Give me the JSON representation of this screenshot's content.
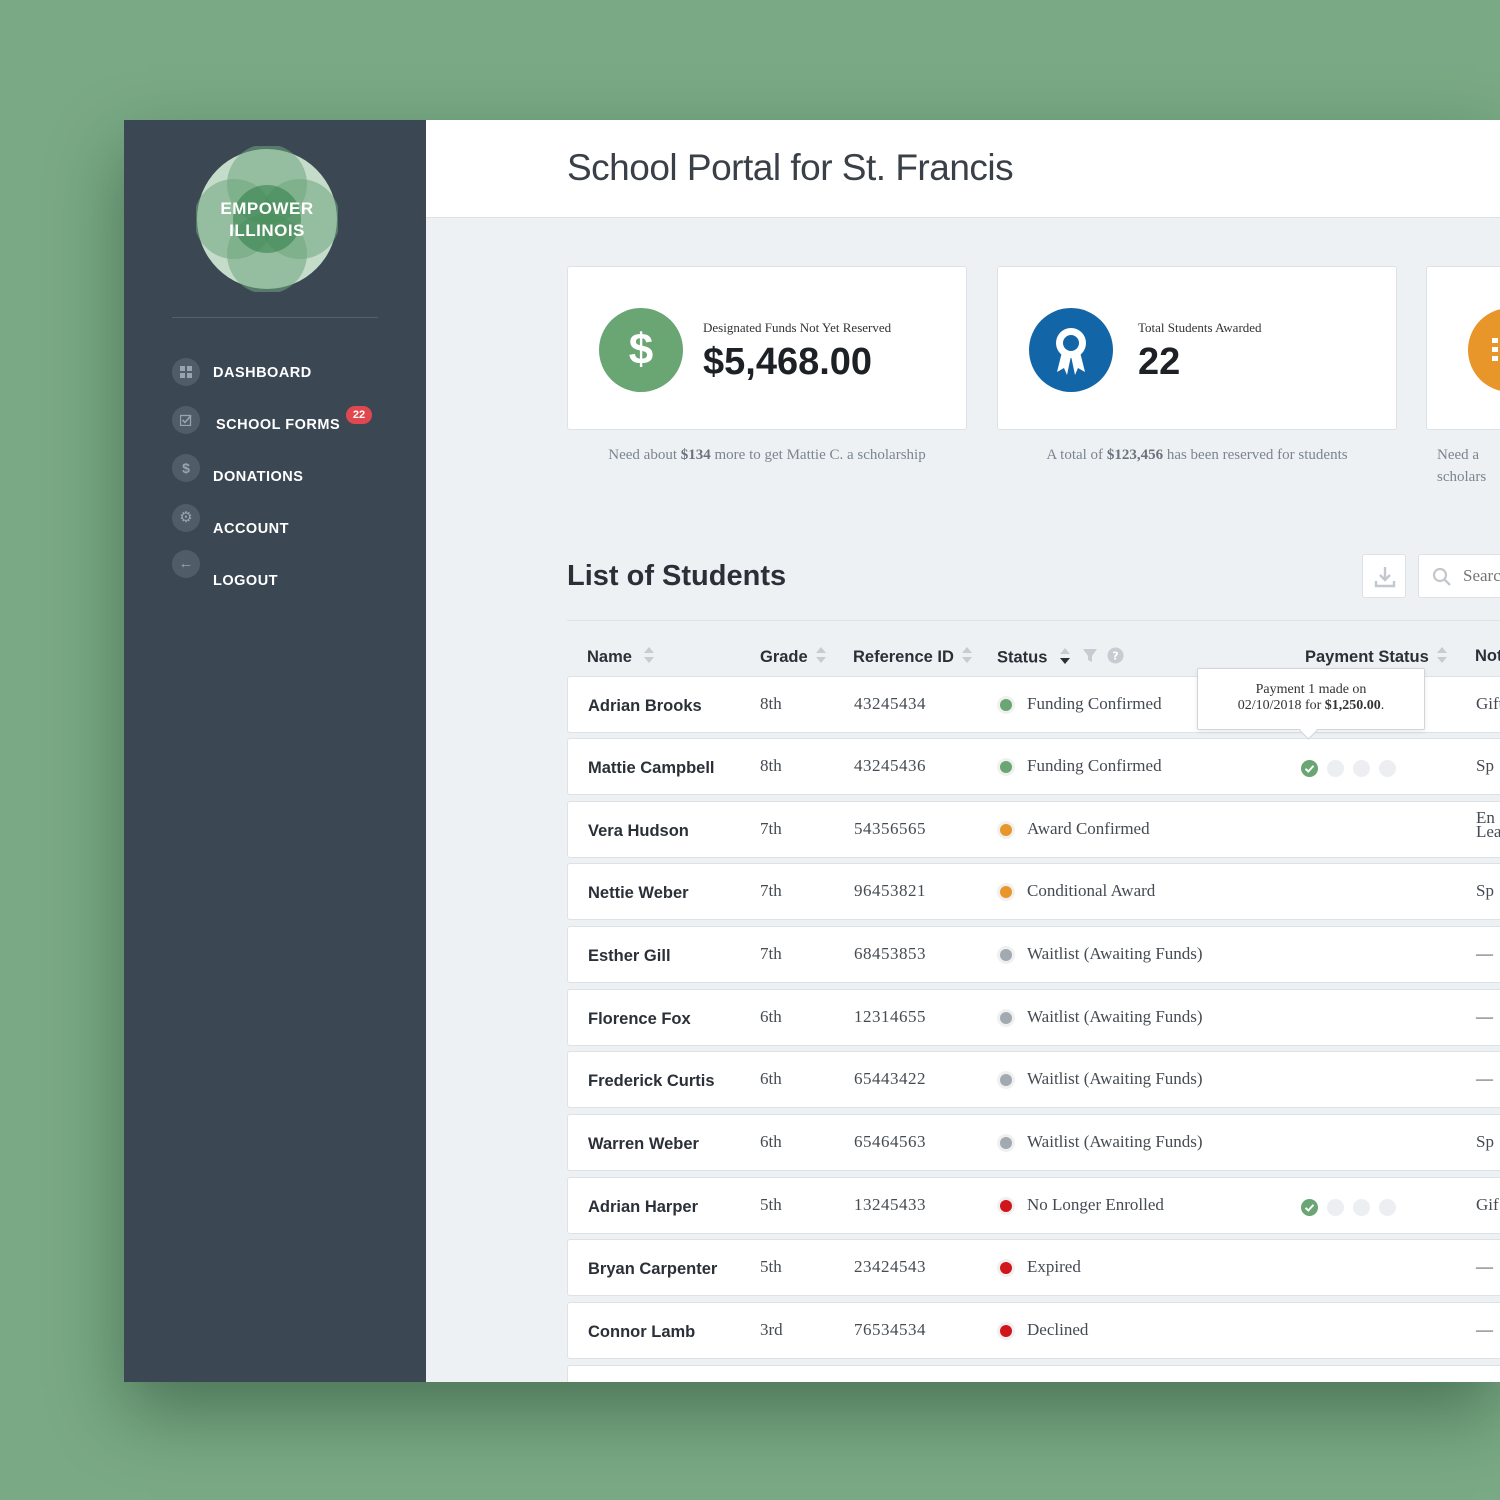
{
  "brand": {
    "logo_text": "EMPOWER\nILLINOIS"
  },
  "colors": {
    "accent_green": "#6aa574",
    "sidebar_bg": "#3c4754",
    "badge_red": "#e0484f",
    "status_orange": "#e8952a",
    "status_gray": "#a3a9b0",
    "status_red": "#d0151b",
    "award_blue": "#1266a8"
  },
  "nav": {
    "items": [
      {
        "label": "DASHBOARD",
        "icon": "grid-icon"
      },
      {
        "label": "SCHOOL FORMS",
        "icon": "checkbox-icon",
        "badge": "22"
      },
      {
        "label": "DONATIONS",
        "icon": "dollar-icon"
      },
      {
        "label": "ACCOUNT",
        "icon": "gear-icon"
      },
      {
        "label": "LOGOUT",
        "icon": "arrow-left-icon"
      }
    ]
  },
  "header": {
    "title": "School Portal for St. Francis"
  },
  "cards": [
    {
      "label": "Designated Funds Not Yet Reserved",
      "value": "$5,468.00",
      "icon": "dollar-icon",
      "note_pre": "Need about ",
      "note_bold": "$134",
      "note_post": " more to get Mattie C. a scholarship"
    },
    {
      "label": "Total Students Awarded",
      "value": "22",
      "icon": "award-ribbon-icon",
      "note_pre": "A total of ",
      "note_bold": "$123,456",
      "note_post": " has been reserved for students"
    },
    {
      "label": "",
      "value": "",
      "icon": "list-icon",
      "note_pre": "Need a",
      "note_bold": "",
      "note_post": " scholars"
    }
  ],
  "students_section": {
    "title": "List of Students",
    "search_placeholder": "Search",
    "columns": {
      "name": "Name",
      "grade": "Grade",
      "ref": "Reference ID",
      "status": "Status",
      "payment": "Payment Status",
      "notes": "Notes"
    },
    "tooltip": {
      "line1": "Payment 1 made on",
      "line2_pre": "02/10/2018 for ",
      "line2_bold": "$1,250.00",
      "line2_post": "."
    },
    "rows": [
      {
        "name": "Adrian Brooks",
        "grade": "8th",
        "ref": "43245434",
        "status": "Funding Confirmed",
        "status_color": "green",
        "payments": [],
        "note": "Gift"
      },
      {
        "name": "Mattie Campbell",
        "grade": "8th",
        "ref": "43245436",
        "status": "Funding Confirmed",
        "status_color": "green",
        "payments": [
          1,
          0,
          0,
          0
        ],
        "note": "Sp"
      },
      {
        "name": "Vera Hudson",
        "grade": "7th",
        "ref": "54356565",
        "status": "Award Confirmed",
        "status_color": "orange",
        "payments": [],
        "note": "En\nLea"
      },
      {
        "name": "Nettie Weber",
        "grade": "7th",
        "ref": "96453821",
        "status": "Conditional Award",
        "status_color": "orange",
        "payments": [],
        "note": "Sp"
      },
      {
        "name": "Esther Gill",
        "grade": "7th",
        "ref": "68453853",
        "status": "Waitlist (Awaiting Funds)",
        "status_color": "gray",
        "payments": [],
        "note": "—"
      },
      {
        "name": "Florence Fox",
        "grade": "6th",
        "ref": "12314655",
        "status": "Waitlist (Awaiting Funds)",
        "status_color": "gray",
        "payments": [],
        "note": "—"
      },
      {
        "name": "Frederick Curtis",
        "grade": "6th",
        "ref": "65443422",
        "status": "Waitlist (Awaiting Funds)",
        "status_color": "gray",
        "payments": [],
        "note": "—"
      },
      {
        "name": "Warren Weber",
        "grade": "6th",
        "ref": "65464563",
        "status": "Waitlist (Awaiting Funds)",
        "status_color": "gray",
        "payments": [],
        "note": "Sp"
      },
      {
        "name": "Adrian Harper",
        "grade": "5th",
        "ref": "13245433",
        "status": "No Longer Enrolled",
        "status_color": "red",
        "payments": [
          1,
          0,
          0,
          0
        ],
        "note": "Gif"
      },
      {
        "name": "Bryan Carpenter",
        "grade": "5th",
        "ref": "23424543",
        "status": "Expired",
        "status_color": "red",
        "payments": [],
        "note": "—"
      },
      {
        "name": "Connor Lamb",
        "grade": "3rd",
        "ref": "76534534",
        "status": "Declined",
        "status_color": "red",
        "payments": [],
        "note": "—"
      }
    ]
  }
}
